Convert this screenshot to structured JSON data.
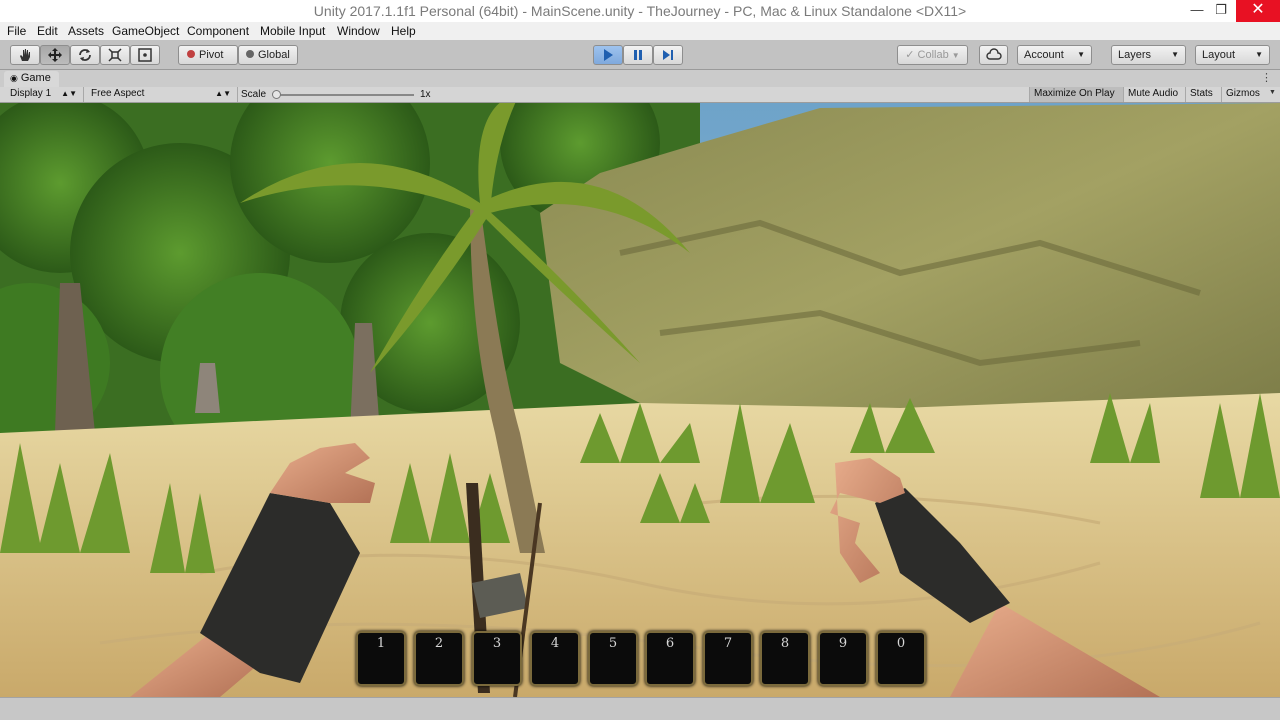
{
  "window": {
    "title": "Unity 2017.1.1f1 Personal (64bit) - MainScene.unity - TheJourney - PC, Mac & Linux Standalone <DX11>"
  },
  "menu": {
    "items": [
      "File",
      "Edit",
      "Assets",
      "GameObject",
      "Component",
      "Mobile Input",
      "Window",
      "Help"
    ]
  },
  "toolbar": {
    "pivot_label": "Pivot",
    "global_label": "Global",
    "collab_label": "Collab",
    "account_label": "Account",
    "layers_label": "Layers",
    "layout_label": "Layout"
  },
  "game_view": {
    "tab_label": "Game",
    "display_label": "Display 1",
    "aspect_label": "Free Aspect",
    "scale_label": "Scale",
    "scale_value": "1x",
    "scale_level": 0.0,
    "toggles": [
      "Maximize On Play",
      "Mute Audio",
      "Stats",
      "Gizmos"
    ],
    "maximize_on_play_active": true
  },
  "hud": {
    "hotbar": [
      "1",
      "2",
      "3",
      "4",
      "5",
      "6",
      "7",
      "8",
      "9",
      "0"
    ]
  },
  "colors": {
    "play_active": "#7fa9dd",
    "close_button": "#e81123",
    "editor_gray": "#c2c2c2"
  }
}
